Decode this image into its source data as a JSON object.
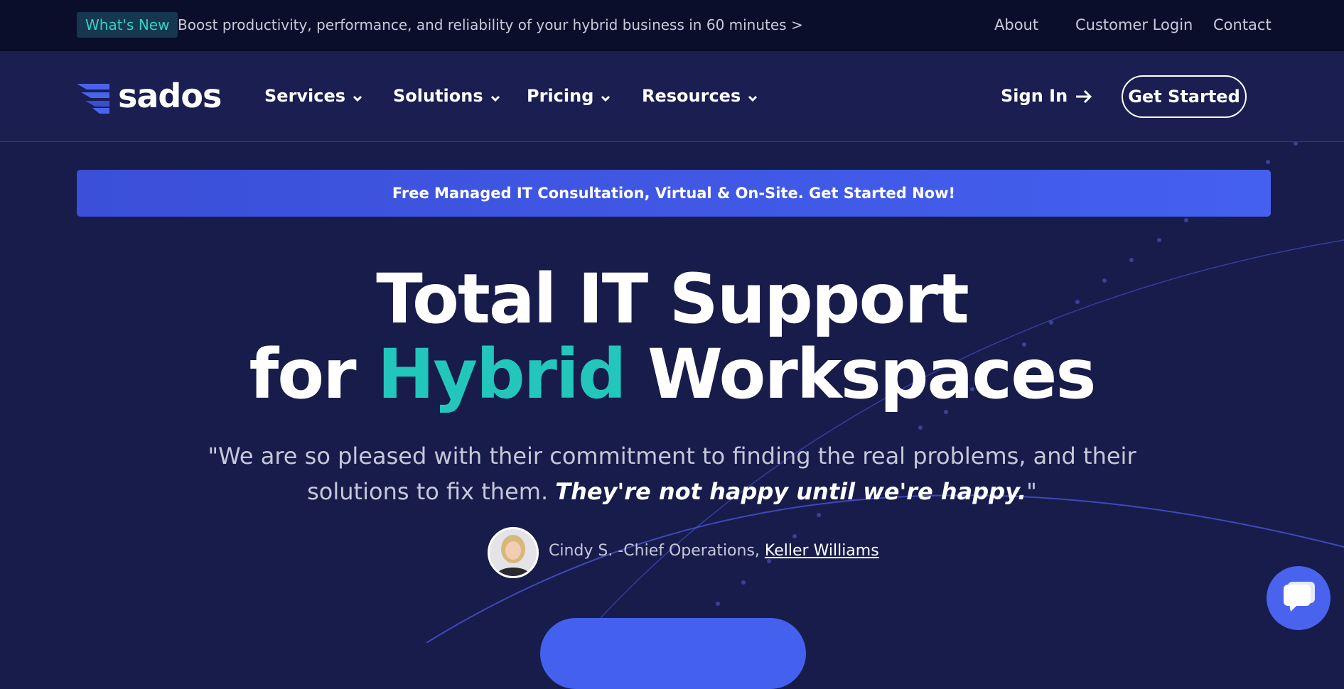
{
  "topbar": {
    "whats_new": "What's New",
    "announcement": "Boost productivity, performance, and reliability of your hybrid business in 60 minutes >",
    "links": [
      "About",
      "Customer Login",
      "Contact"
    ]
  },
  "nav": {
    "logo_text": "sados",
    "items": [
      "Services",
      "Solutions",
      "Pricing",
      "Resources"
    ],
    "sign_in": "Sign In",
    "get_started": "Get Started"
  },
  "banner": {
    "text": "Free Managed IT Consultation, Virtual & On-Site. Get Started Now!"
  },
  "hero": {
    "line1": "Total IT Support",
    "line2_before": "for",
    "line2_accent": "Hybrid",
    "line2_after": "Workspaces"
  },
  "testimonial": {
    "quote": "\"We are so pleased with their commitment to finding the real problems, and their solutions to fix them.",
    "quote_emphasis": "They're not happy until we're happy.",
    "quote_close": "\"",
    "author": "Cindy S. -Chief Operations,",
    "company": "Keller Williams"
  },
  "colors": {
    "accent": "#23c6bb",
    "primary": "#4460ef",
    "background": "#171c4b"
  }
}
